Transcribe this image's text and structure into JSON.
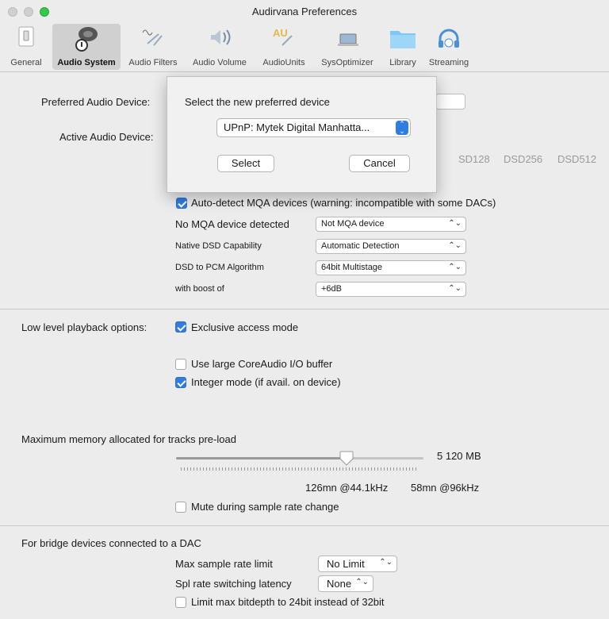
{
  "window": {
    "title": "Audirvana Preferences"
  },
  "toolbar": {
    "items": [
      {
        "label": "General",
        "icon": "switch-icon"
      },
      {
        "label": "Audio System",
        "icon": "speaker-icon"
      },
      {
        "label": "Audio Filters",
        "icon": "waveform-icon"
      },
      {
        "label": "Audio Volume",
        "icon": "volume-icon"
      },
      {
        "label": "AudioUnits",
        "icon": "au-icon"
      },
      {
        "label": "SysOptimizer",
        "icon": "laptop-icon"
      },
      {
        "label": "Library",
        "icon": "folder-icon"
      },
      {
        "label": "Streaming",
        "icon": "headphones-icon"
      }
    ],
    "active": "Audio System"
  },
  "audio_device": {
    "preferred_label": "Preferred Audio Device:",
    "active_label": "Active Audio Device:",
    "dsd_formats": [
      "DSD128",
      "DSD256",
      "DSD512"
    ],
    "dsd_partial": "SD128"
  },
  "dialog": {
    "prompt": "Select the new preferred device",
    "device_value": "UPnP: Mytek Digital Manhatta...",
    "select_label": "Select",
    "cancel_label": "Cancel"
  },
  "mqa": {
    "auto_detect_label": "Auto-detect MQA devices (warning: incompatible with some DACs)",
    "auto_detect_checked": true,
    "status_label": "No MQA device detected",
    "status_value": "Not MQA device"
  },
  "dsd": {
    "capability_label": "Native DSD Capability",
    "capability_value": "Automatic Detection",
    "algorithm_label": "DSD to PCM Algorithm",
    "algorithm_value": "64bit Multistage",
    "boost_label": "with boost of",
    "boost_value": "+6dB"
  },
  "playback": {
    "section_label": "Low level playback options:",
    "exclusive_label": "Exclusive access mode",
    "exclusive_checked": true,
    "large_buffer_label": "Use large CoreAudio I/O buffer",
    "large_buffer_checked": false,
    "integer_label": "Integer mode (if avail. on device)",
    "integer_checked": true
  },
  "memory": {
    "section_label": "Maximum memory allocated for tracks pre-load",
    "value_label": "5 120  MB",
    "slider_fraction": 0.69,
    "duration_44": "126mn @44.1kHz",
    "duration_96": "58mn @96kHz",
    "mute_label": "Mute during sample rate change",
    "mute_checked": false
  },
  "bridge": {
    "section_label": "For bridge devices connected to a DAC",
    "max_rate_label": "Max sample rate limit",
    "max_rate_value": "No Limit",
    "latency_label": "Spl rate switching latency",
    "latency_value": "None",
    "limit_bitdepth_label": "Limit max bitdepth to 24bit instead of 32bit",
    "limit_bitdepth_checked": false
  },
  "colors": {
    "accent": "#2f7de1",
    "close": "#fc605c",
    "minimize": "#fdbc40",
    "zoom": "#34c84a",
    "window_bg": "#ececec"
  }
}
